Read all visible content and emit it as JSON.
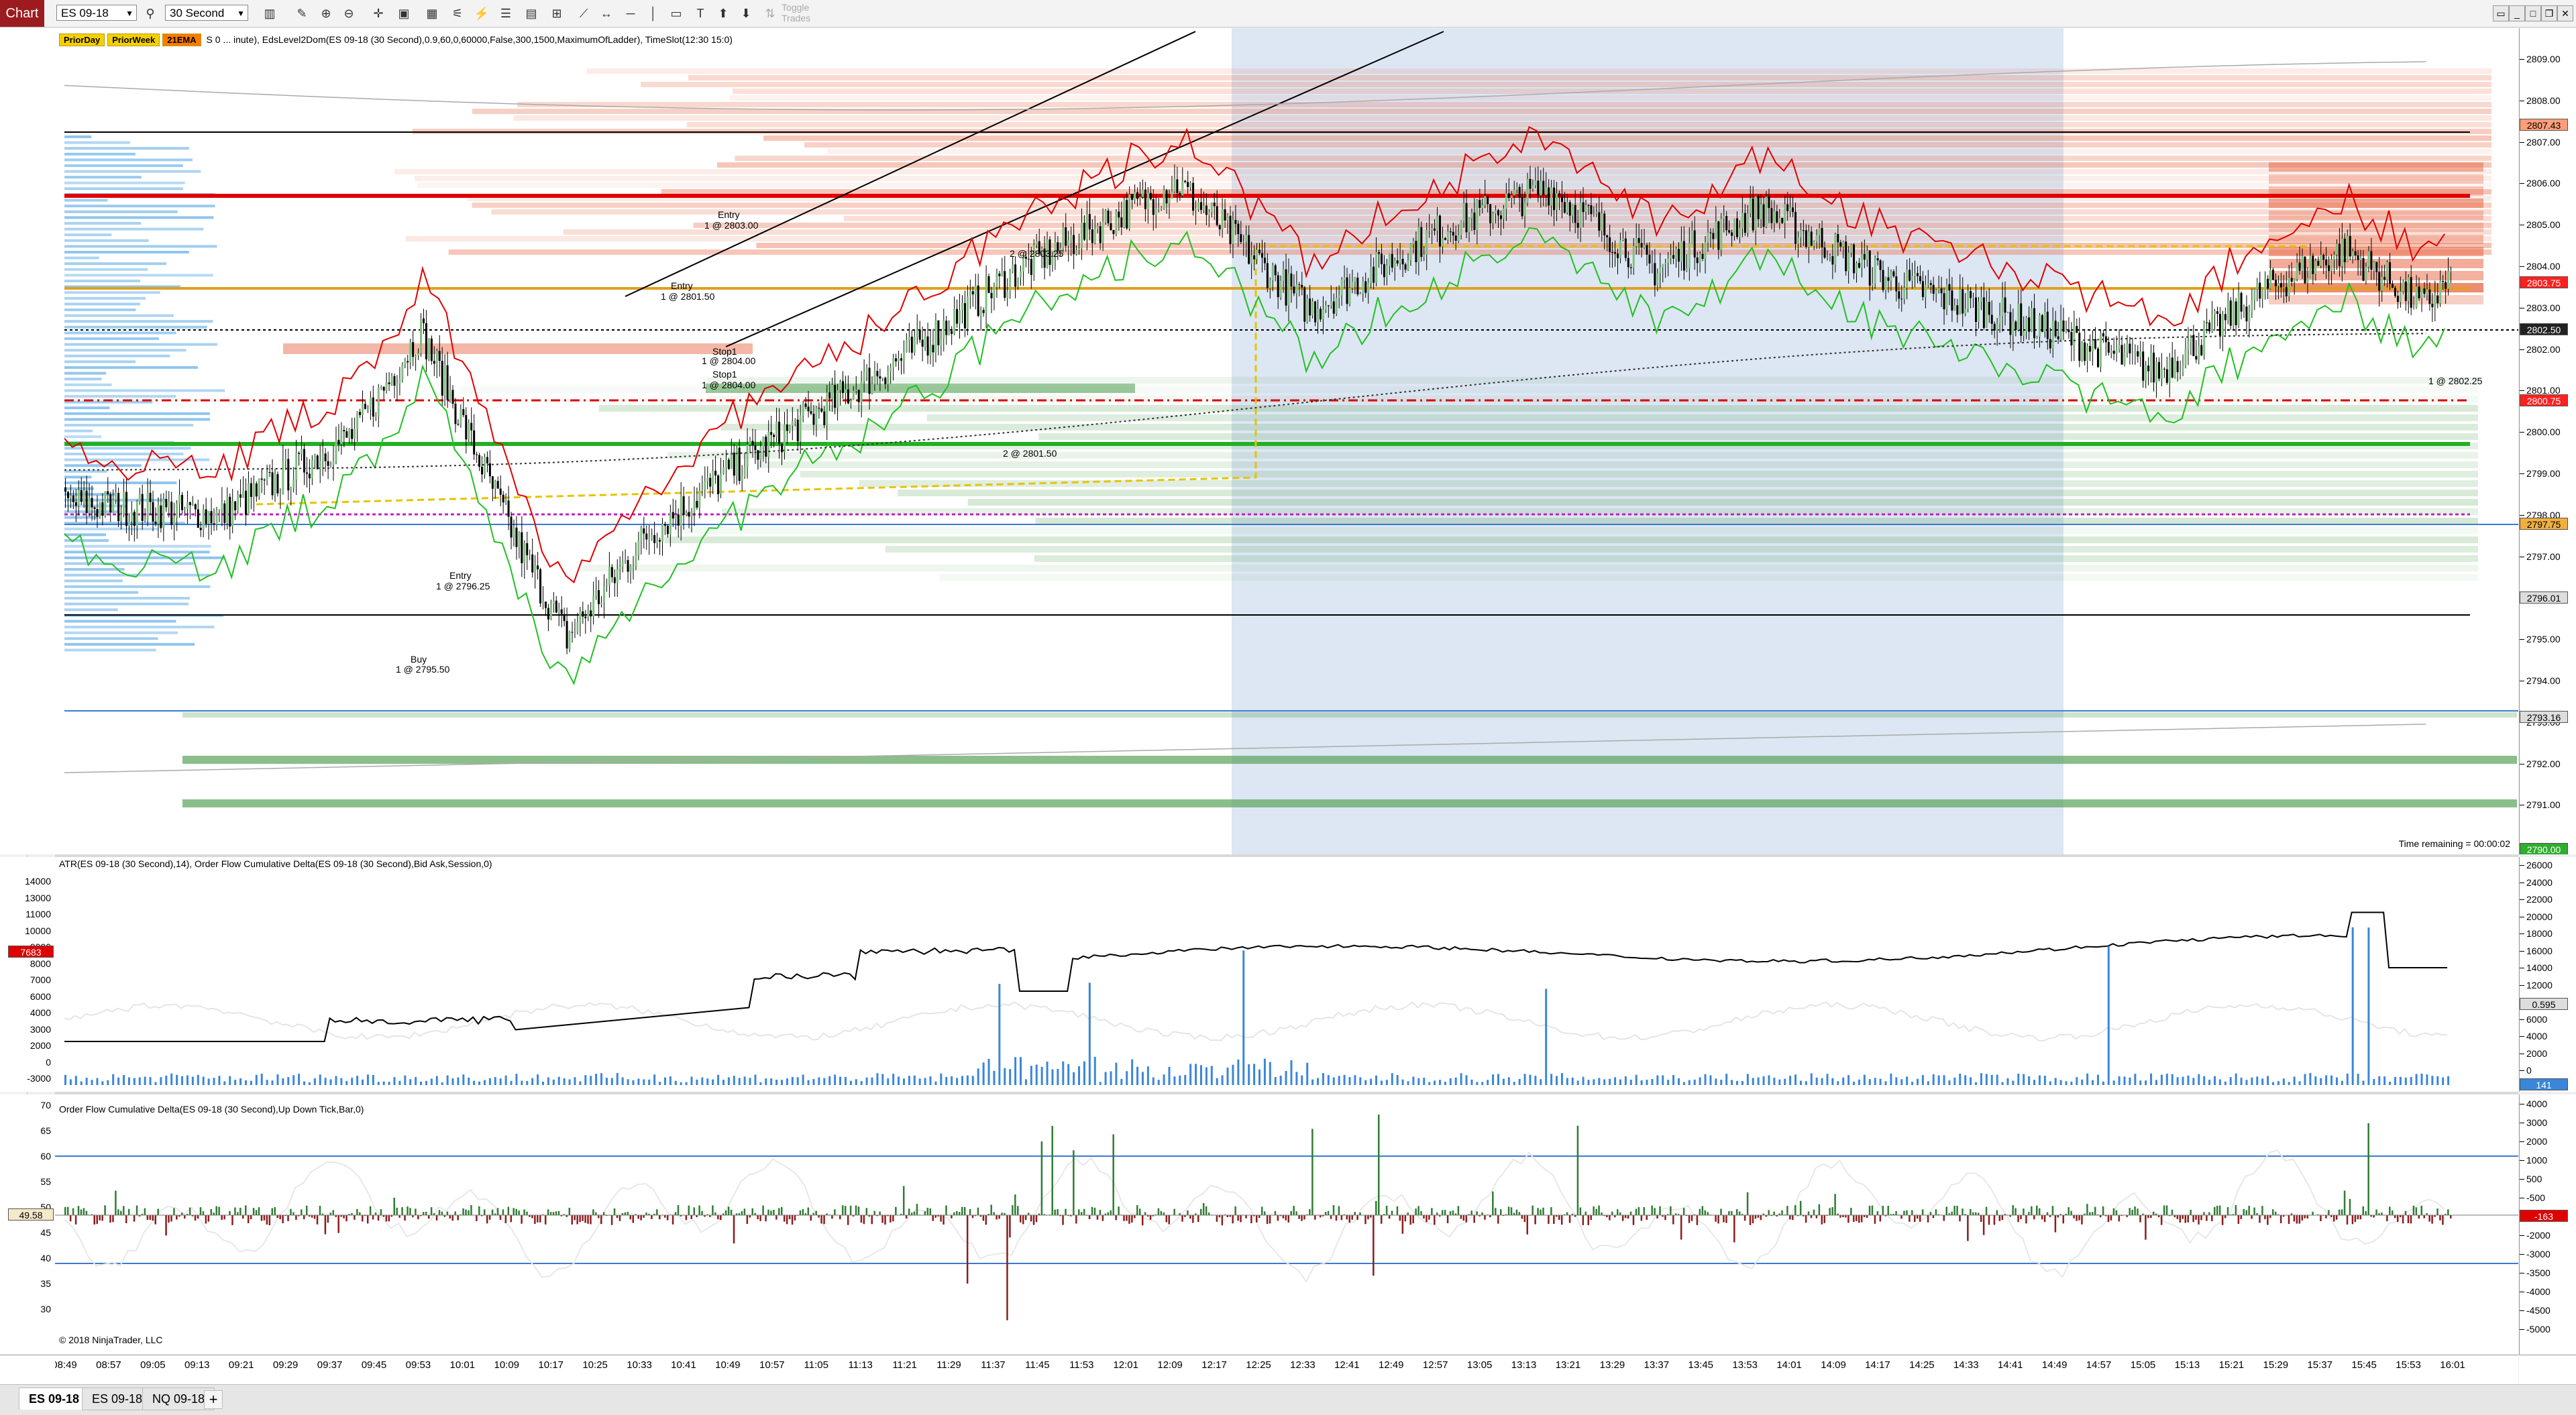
{
  "toolbar": {
    "badge": "Chart",
    "instrument": "ES 09-18",
    "interval": "30 Second",
    "toggle_trades": "Toggle Trades"
  },
  "price_panel": {
    "legend_badges": [
      "PriorDay",
      "PriorWeek",
      "21EMA"
    ],
    "legend_text": "S 0 ... inute), EdsLevel2Dom(ES 09-18 (30 Second),0.9,60,0,60000,False,300,1500,MaximumOfLadder), TimeSlot(12:30 15:0)",
    "time_remaining": "Time remaining = 00:00:02",
    "axis_ticks": [
      "2809.00",
      "2808.00",
      "2807.00",
      "2806.00",
      "2805.00",
      "2804.00",
      "2803.00",
      "2802.00",
      "2801.00",
      "2800.00",
      "2799.00",
      "2798.00",
      "2797.00",
      "2796.00",
      "2795.00",
      "2794.00",
      "2793.00",
      "2792.00",
      "2791.00",
      "2790.00"
    ],
    "axis_tags": [
      {
        "text": "2807.43",
        "bg": "#ff9f7a"
      },
      {
        "text": "2803.75",
        "bg": "#ff2020"
      },
      {
        "text": "2802.50",
        "bg": "#222222"
      },
      {
        "text": "2800.75",
        "bg": "#ff2020"
      },
      {
        "text": "2797.75",
        "bg": "#f0b040"
      },
      {
        "text": "2796.01",
        "bg": "#dddddd"
      },
      {
        "text": "2793.16",
        "bg": "#dddddd"
      },
      {
        "text": "2790.00",
        "bg": "#2fae2f"
      }
    ],
    "annotations": [
      {
        "text": "Entry"
      },
      {
        "text": "1 @ 2803.00"
      },
      {
        "text": "Entry"
      },
      {
        "text": "1 @ 2801.50"
      },
      {
        "text": "Stop1"
      },
      {
        "text": "1 @ 2804.00"
      },
      {
        "text": "Stop1"
      },
      {
        "text": "1 @ 2804.00"
      },
      {
        "text": "2 @ 2803.25"
      },
      {
        "text": "2 @ 2801.50"
      },
      {
        "text": "Entry"
      },
      {
        "text": "1 @ 2796.25"
      },
      {
        "text": "Buy"
      },
      {
        "text": "1 @ 2795.50"
      },
      {
        "text": "1 @ 2802.25"
      }
    ]
  },
  "atr_panel": {
    "legend_text": "ATR(ES 09-18 (30 Second),14), Order Flow Cumulative Delta(ES 09-18 (30 Second),Bid Ask,Session,0)",
    "left_ticks": [
      "14000",
      "13000",
      "11000",
      "10000",
      "9000",
      "8000",
      "7000",
      "6000",
      "4000",
      "3000",
      "2000",
      "0",
      "-3000"
    ],
    "left_tag": "7683",
    "right_ticks": [
      "26000",
      "24000",
      "22000",
      "20000",
      "18000",
      "16000",
      "14000",
      "12000",
      "8000",
      "6000",
      "4000",
      "2000",
      "0"
    ],
    "right_tags": [
      {
        "text": "0.595",
        "bg": "#dddddd"
      },
      {
        "text": "141",
        "bg": "#3a86d8"
      }
    ]
  },
  "delta_panel": {
    "legend_text": "Order Flow Cumulative Delta(ES 09-18 (30 Second),Up Down Tick,Bar,0)",
    "left_ticks": [
      "70",
      "65",
      "60",
      "55",
      "50",
      "45",
      "40",
      "35",
      "30"
    ],
    "left_tag": "49.58",
    "right_ticks": [
      "4000",
      "3000",
      "2000",
      "1000",
      "500",
      "-500",
      "-1000",
      "-2000",
      "-3000",
      "-3500",
      "-4000",
      "-4500",
      "-5000"
    ],
    "right_tag": "-163"
  },
  "copyright": "© 2018 NinjaTrader, LLC",
  "time_axis": [
    "08:49",
    "08:57",
    "09:05",
    "09:13",
    "09:21",
    "09:29",
    "09:37",
    "09:45",
    "09:53",
    "10:01",
    "10:09",
    "10:17",
    "10:25",
    "10:33",
    "10:41",
    "10:49",
    "10:57",
    "11:05",
    "11:13",
    "11:21",
    "11:29",
    "11:37",
    "11:45",
    "11:53",
    "12:01",
    "12:09",
    "12:17",
    "12:25",
    "12:33",
    "12:41",
    "12:49",
    "12:57",
    "13:05",
    "13:13",
    "13:21",
    "13:29",
    "13:37",
    "13:45",
    "13:53",
    "14:01",
    "14:09",
    "14:17",
    "14:25",
    "14:33",
    "14:41",
    "14:49",
    "14:57",
    "15:05",
    "15:13",
    "15:21",
    "15:29",
    "15:37",
    "15:45",
    "15:53",
    "16:01"
  ],
  "tabs": [
    "ES 09-18",
    "ES 09-18",
    "NQ 09-18"
  ],
  "colors": {
    "session_highlight": "#dde6f3",
    "ask_heat": "#e8704f",
    "bid_heat": "#5aa35a",
    "bid_ladder": "#8cc3ec",
    "red_level": "#e00000",
    "orange_level": "#e0a020",
    "green_level": "#22b022",
    "magenta_level": "#c020c0"
  }
}
